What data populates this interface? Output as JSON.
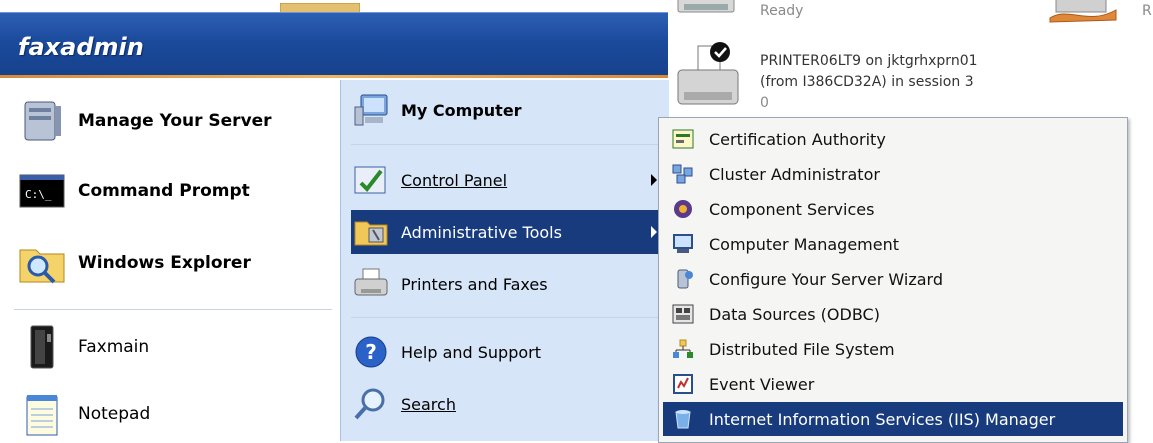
{
  "user": {
    "name": "faxadmin"
  },
  "printer_window": {
    "status_ready": "Ready",
    "status_ready_2": "R",
    "printer_line1": "PRINTER06LT9 on jktgrhxprn01",
    "printer_line2": "(from I386CD32A) in session 3",
    "printer_count": "0"
  },
  "left_pane": {
    "pinned": [
      {
        "label": "Manage Your Server",
        "icon": "server-manager-icon"
      },
      {
        "label": "Command Prompt",
        "icon": "command-prompt-icon"
      },
      {
        "label": "Windows Explorer",
        "icon": "windows-explorer-icon"
      }
    ],
    "recent": [
      {
        "label": "Faxmain",
        "icon": "faxmain-icon"
      },
      {
        "label": "Notepad",
        "icon": "notepad-icon"
      }
    ]
  },
  "right_pane": {
    "my_computer": "My Computer",
    "control_panel": "Control Panel",
    "administrative_tools": "Administrative Tools",
    "printers_and_faxes": "Printers and Faxes",
    "help_and_support": "Help and Support",
    "search": "Search"
  },
  "admin_submenu": {
    "items": [
      "Certification Authority",
      "Cluster Administrator",
      "Component Services",
      "Computer Management",
      "Configure Your Server Wizard",
      "Data Sources (ODBC)",
      "Distributed File System",
      "Event Viewer",
      "Internet Information Services (IIS) Manager"
    ],
    "selected": "Internet Information Services (IIS) Manager"
  },
  "colors": {
    "header_blue": "#1b4a9c",
    "highlight_navy": "#173b7c",
    "right_pane_bg": "#d7e5f8"
  }
}
